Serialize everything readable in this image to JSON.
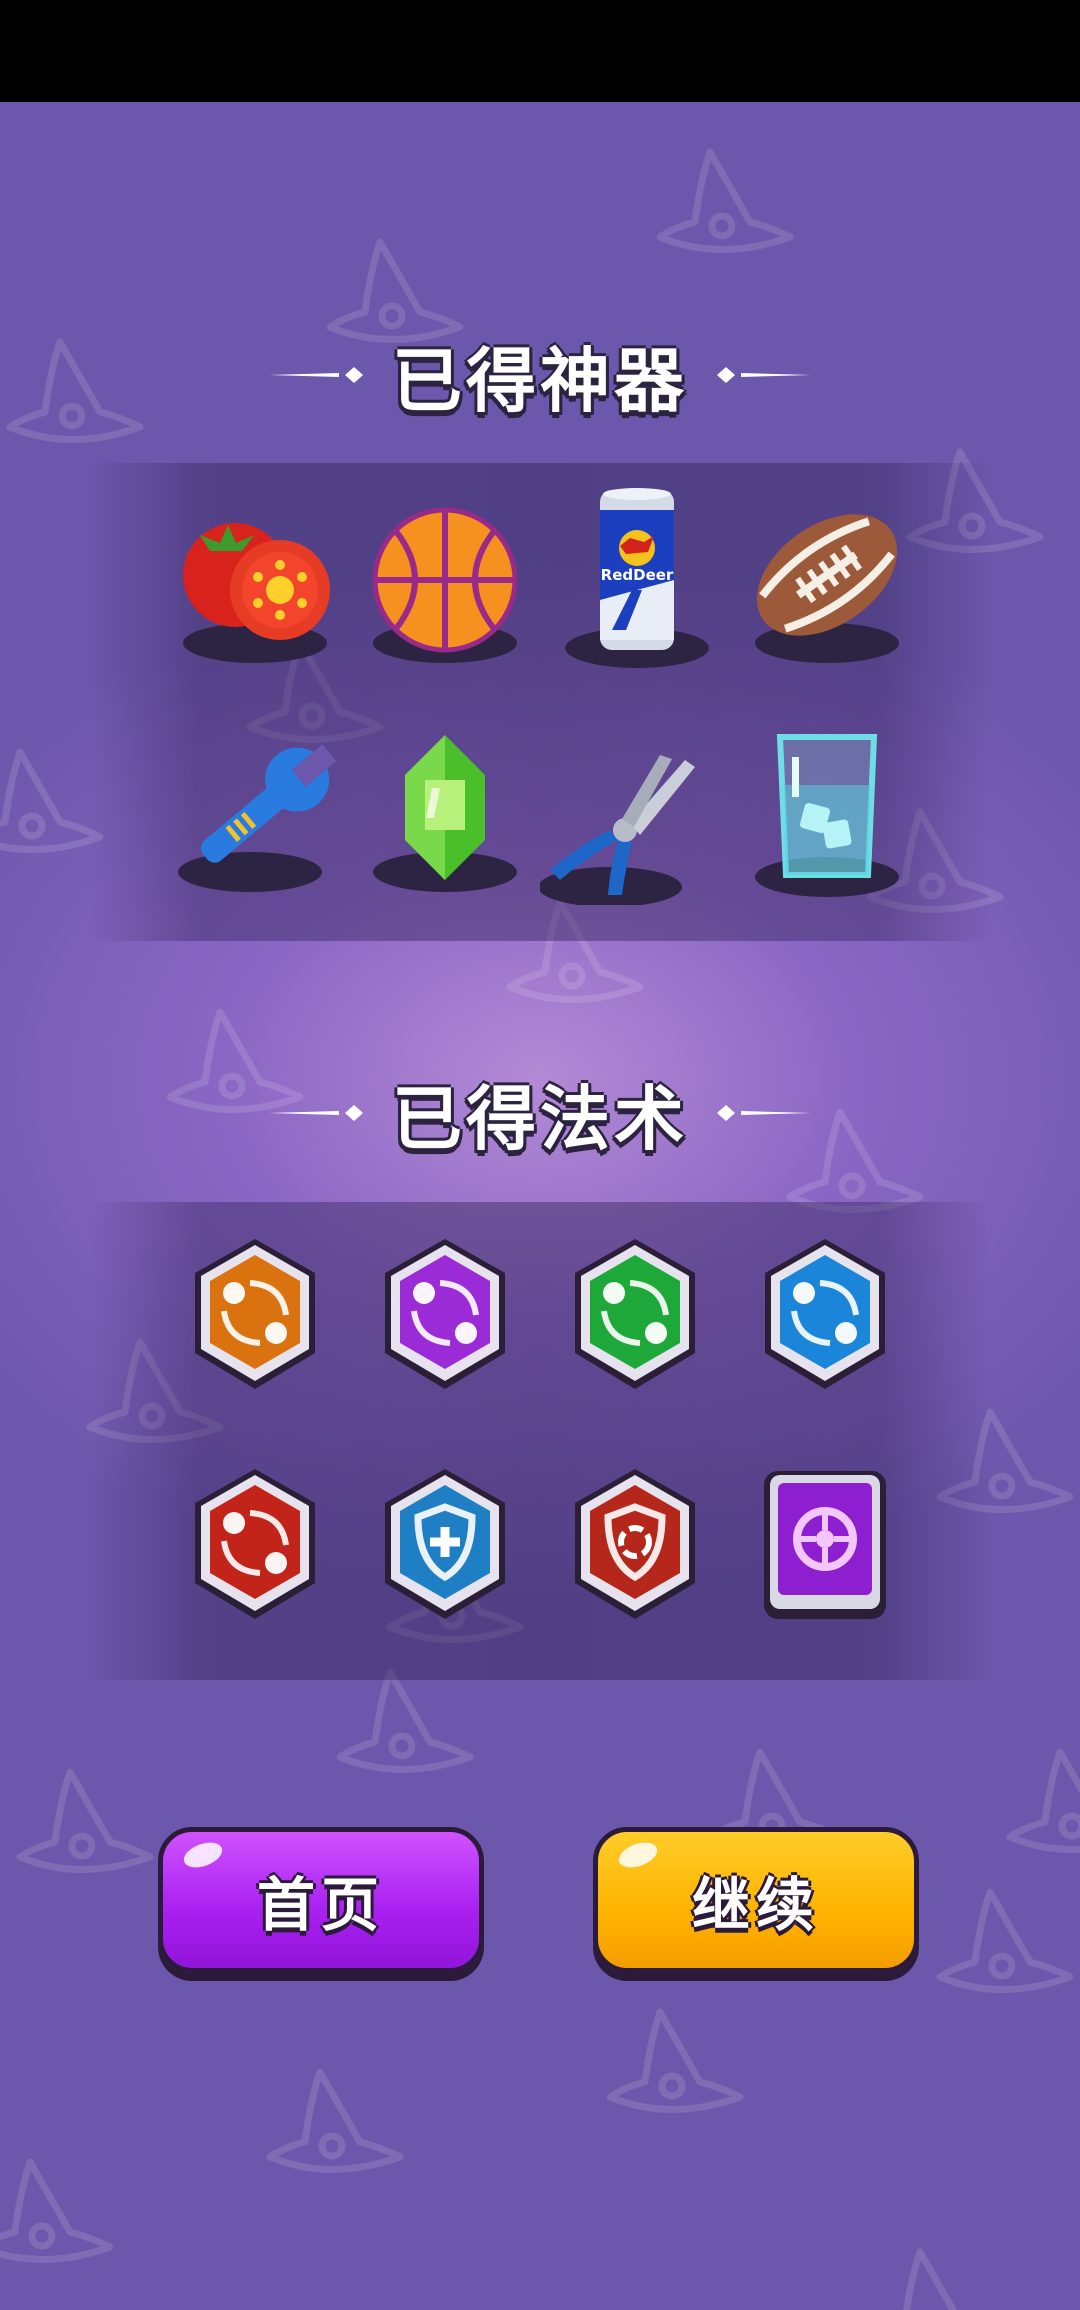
{
  "status_bar": {},
  "artifacts_section": {
    "title": "已得神器",
    "items": [
      {
        "icon": "tomato-icon"
      },
      {
        "icon": "basketball-icon"
      },
      {
        "icon": "energy-drink-can-icon",
        "can_text": "RedDeer"
      },
      {
        "icon": "american-football-icon"
      },
      {
        "icon": "wrench-icon"
      },
      {
        "icon": "green-crystal-icon"
      },
      {
        "icon": "pliers-icon"
      },
      {
        "icon": "ice-water-glass-icon"
      }
    ]
  },
  "spells_section": {
    "title": "已得法术",
    "items": [
      {
        "icon": "orange-swap-spell-icon",
        "color": "#d9720f"
      },
      {
        "icon": "purple-swap-spell-icon",
        "color": "#9b2bd6"
      },
      {
        "icon": "green-swap-spell-icon",
        "color": "#1ea83a"
      },
      {
        "icon": "blue-swap-spell-icon",
        "color": "#1b86d9"
      },
      {
        "icon": "red-swap-spell-icon",
        "color": "#c3241a"
      },
      {
        "icon": "shield-heal-spell-icon",
        "color": "#1e7fc4"
      },
      {
        "icon": "shield-refresh-spell-icon",
        "color": "#b4271a"
      },
      {
        "icon": "turtle-shell-spell-icon",
        "color": "#8e1fd0"
      }
    ]
  },
  "buttons": {
    "home_label": "首页",
    "continue_label": "继续"
  },
  "colors": {
    "background": "#7a5fb8",
    "home_button": "#a81ff0",
    "continue_button": "#ffb300"
  }
}
